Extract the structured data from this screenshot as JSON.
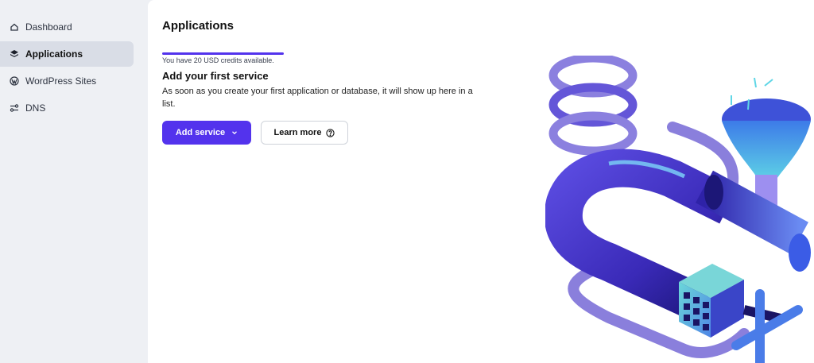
{
  "sidebar": {
    "items": [
      {
        "label": "Dashboard",
        "icon": "home-icon",
        "active": false
      },
      {
        "label": "Applications",
        "icon": "layers-icon",
        "active": true
      },
      {
        "label": "WordPress Sites",
        "icon": "wordpress-icon",
        "active": false
      },
      {
        "label": "DNS",
        "icon": "dns-icon",
        "active": false
      }
    ]
  },
  "main": {
    "title": "Applications",
    "credits_text": "You have 20 USD credits available.",
    "empty_state": {
      "title": "Add your first service",
      "description": "As soon as you create your first application or database, it will show up here in a list."
    },
    "buttons": {
      "add_service": "Add service",
      "learn_more": "Learn more"
    }
  },
  "colors": {
    "accent": "#5333ed",
    "sidebar_bg": "#eef0f4",
    "active_item_bg": "#d9dde6"
  }
}
